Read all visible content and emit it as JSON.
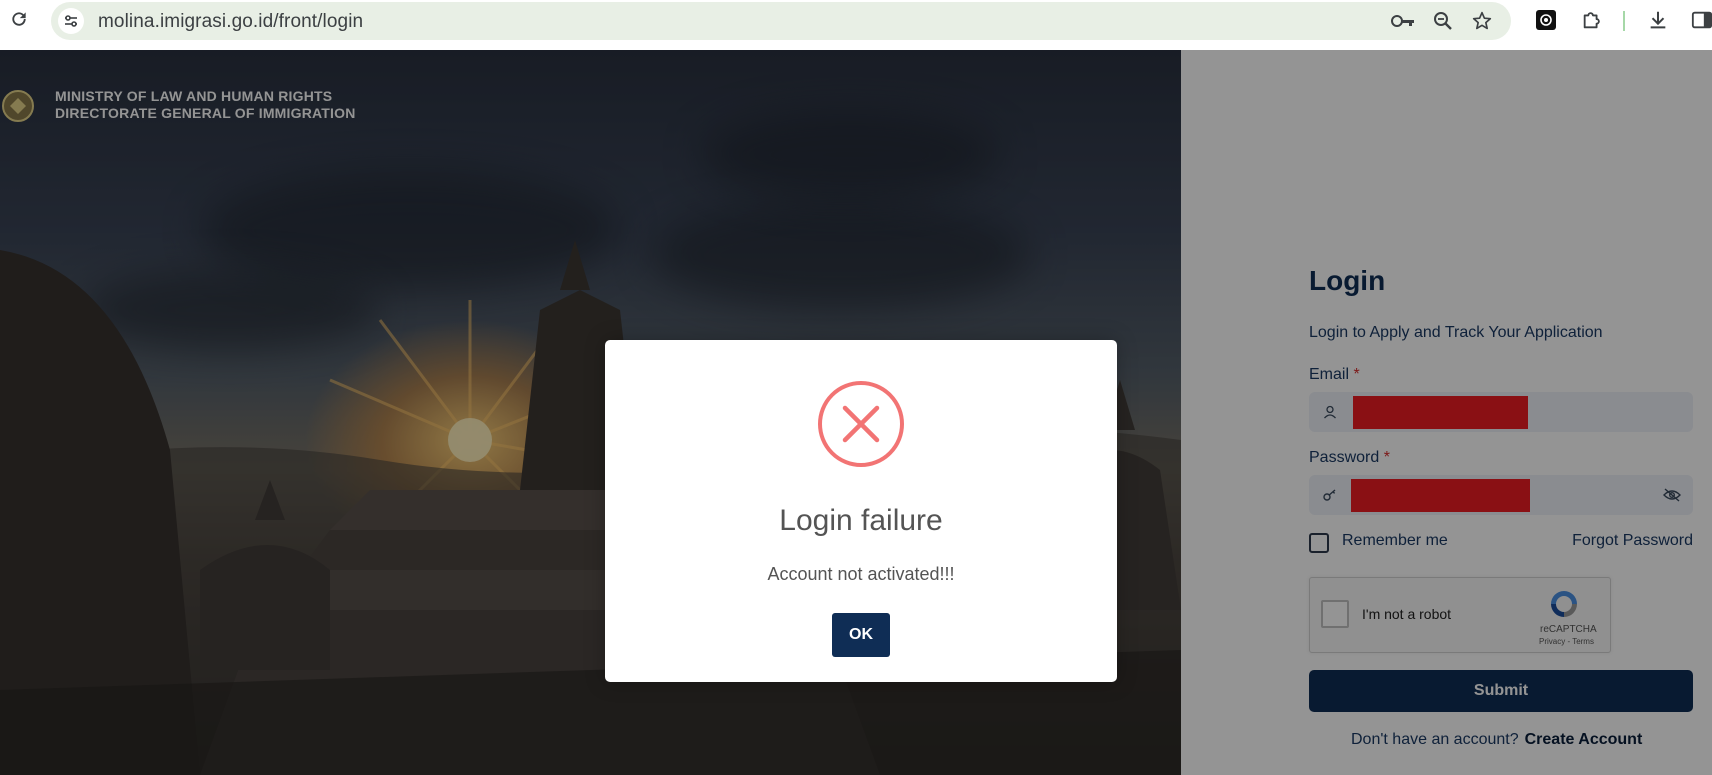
{
  "browser": {
    "url": "molina.imigrasi.go.id/front/login",
    "icons": [
      "reload-icon",
      "site-info-icon",
      "password-key-icon",
      "zoom-icon",
      "bookmark-star-icon",
      "extension-app-icon",
      "extensions-puzzle-icon",
      "download-icon",
      "side-panel-icon"
    ]
  },
  "header": {
    "ministry_line1": "MINISTRY OF  LAW  AND HUMAN RIGHTS",
    "ministry_line2": "DIRECTORATE GENERAL OF IMMIGRATION"
  },
  "login": {
    "title": "Login",
    "subtitle": "Login to Apply and Track Your Application",
    "email_label": "Email",
    "password_label": "Password",
    "required_mark": "*",
    "remember_label": "Remember me",
    "forgot_label": "Forgot Password",
    "submit_label": "Submit",
    "no_account_text": "Don't have an account?",
    "create_account_label": "Create Account"
  },
  "recaptcha": {
    "label": "I'm not a robot",
    "brand": "reCAPTCHA",
    "links": "Privacy - Terms"
  },
  "modal": {
    "title": "Login failure",
    "message": "Account not activated!!!",
    "ok_label": "OK"
  },
  "colors": {
    "primary": "#0f2d55",
    "error": "#f27474",
    "redaction": "#ee1c24",
    "omnibox": "#e8efe5"
  }
}
